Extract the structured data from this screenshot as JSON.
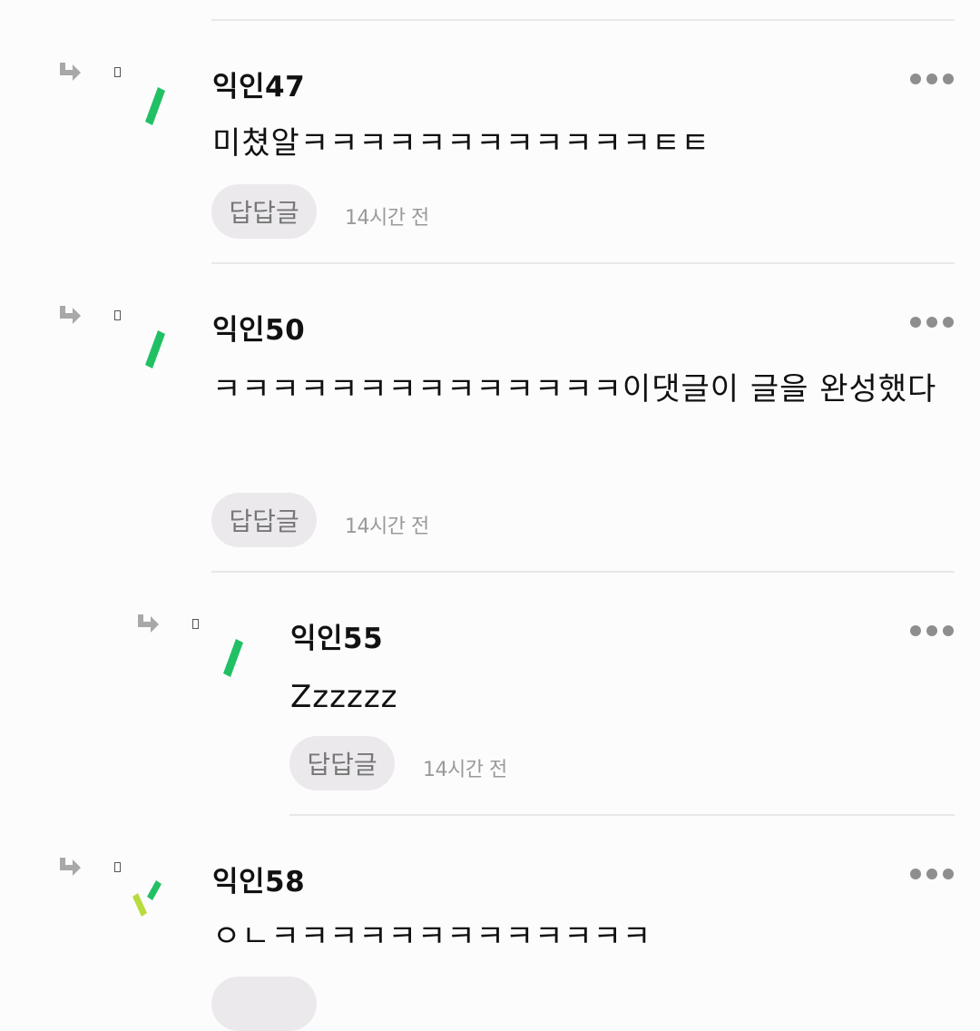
{
  "icons": {
    "reply_indicator": "reply-arrow-icon",
    "more": "more-dots-icon",
    "avatar": "green-leaf-avatar-icon"
  },
  "colors": {
    "avatar_green": "#22c064",
    "avatar_lime": "#b7dc3e",
    "button_bg": "#ebe9ec",
    "divider": "#e9e7ea",
    "muted_text": "#9a9a9a"
  },
  "comments": [
    {
      "author": "익인47",
      "text": "미쳤알ㅋㅋㅋㅋㅋㅋㅋㅋㅋㅋㅋㅋㅌㅌ",
      "reply_label": "답답글",
      "time": "14시간 전"
    },
    {
      "author": "익인50",
      "text": "ㅋㅋㅋㅋㅋㅋㅋㅋㅋㅋㅋㅋㅋㅋ이댓글이 글을 완성했다",
      "reply_label": "답답글",
      "time": "14시간 전"
    },
    {
      "author": "익인55",
      "text": "Zzzzzz",
      "reply_label": "답답글",
      "time": "14시간 전"
    },
    {
      "author": "익인58",
      "text": "ㅇㄴㅋㅋㅋㅋㅋㅋㅋㅋㅋㅋㅋㅋㅋ"
    }
  ]
}
